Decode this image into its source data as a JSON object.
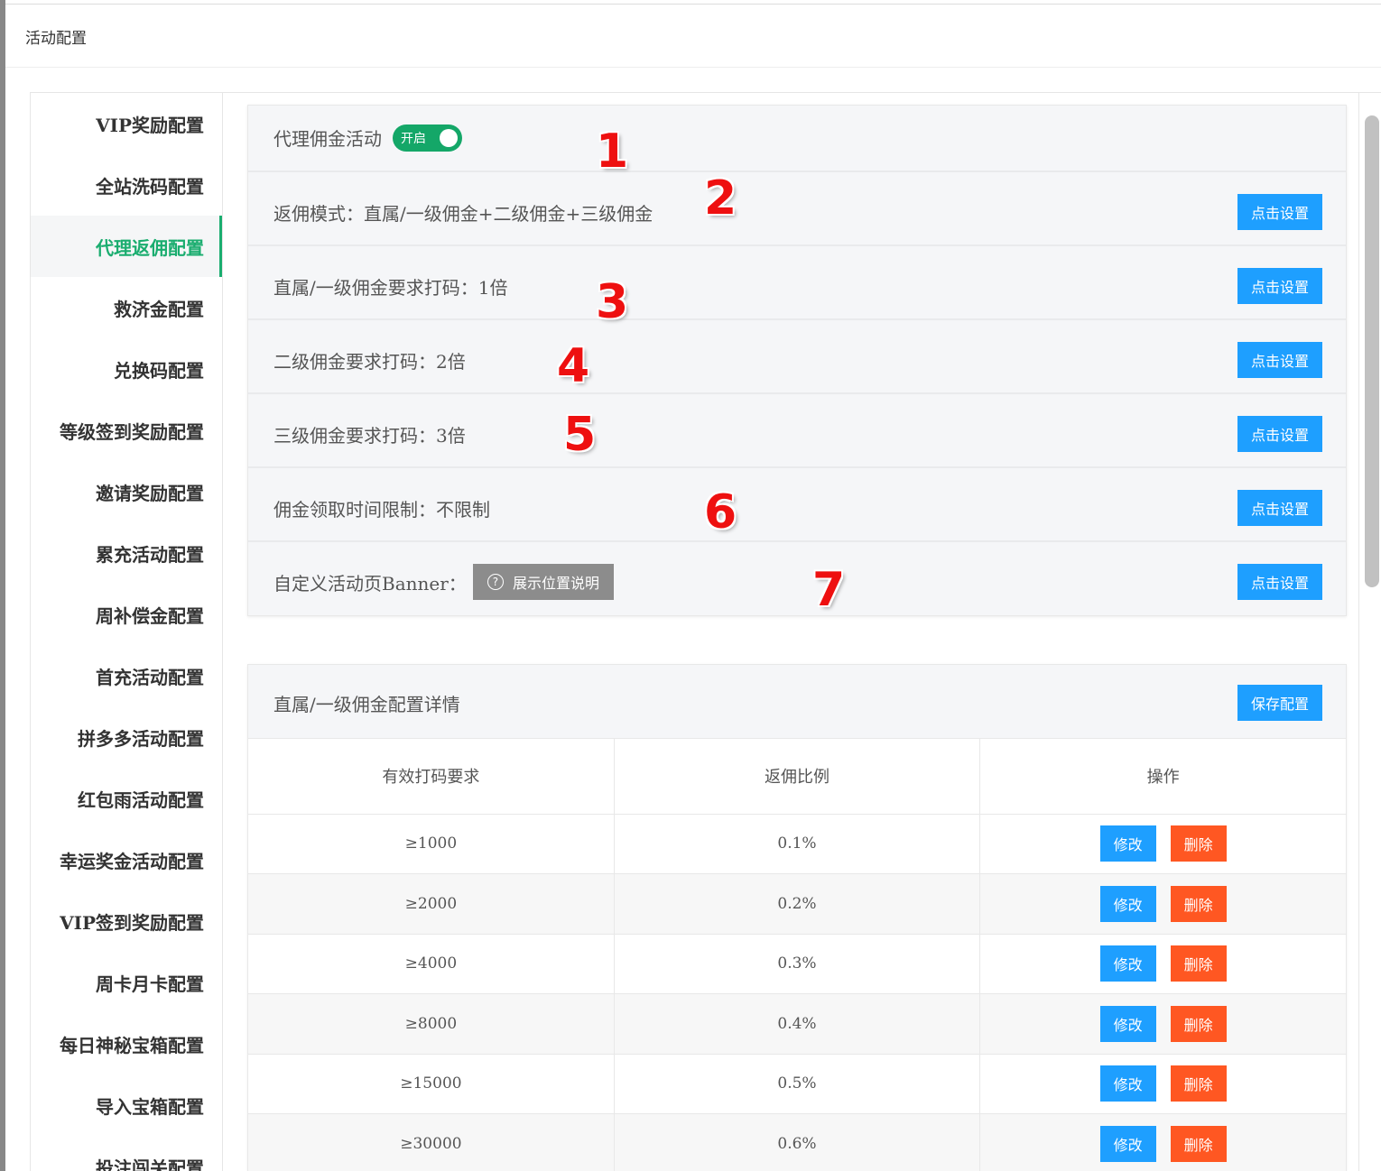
{
  "page_title": "活动配置",
  "sidebar": {
    "items": [
      {
        "label": "VIP奖励配置"
      },
      {
        "label": "全站洗码配置"
      },
      {
        "label": "代理返佣配置"
      },
      {
        "label": "救济金配置"
      },
      {
        "label": "兑换码配置"
      },
      {
        "label": "等级签到奖励配置"
      },
      {
        "label": "邀请奖励配置"
      },
      {
        "label": "累充活动配置"
      },
      {
        "label": "周补偿金配置"
      },
      {
        "label": "首充活动配置"
      },
      {
        "label": "拼多多活动配置"
      },
      {
        "label": "红包雨活动配置"
      },
      {
        "label": "幸运奖金活动配置"
      },
      {
        "label": "VIP签到奖励配置"
      },
      {
        "label": "周卡月卡配置"
      },
      {
        "label": "每日神秘宝箱配置"
      },
      {
        "label": "导入宝箱配置"
      },
      {
        "label": "投注闯关配置"
      }
    ],
    "active": "代理返佣配置"
  },
  "settings": {
    "activity_label": "代理佣金活动",
    "toggle_label": "开启",
    "toggle_on": true,
    "mode_label": "返佣模式：直属/一级佣金+二级佣金+三级佣金",
    "level1_label": "直属/一级佣金要求打码：1倍",
    "level2_label": "二级佣金要求打码：2倍",
    "level3_label": "三级佣金要求打码：3倍",
    "time_label": "佣金领取时间限制：不限制",
    "banner_label": "自定义活动页Banner：",
    "banner_help_button": "展示位置说明",
    "set_button": "点击设置"
  },
  "annotations": [
    "1",
    "2",
    "3",
    "4",
    "5",
    "6",
    "7"
  ],
  "detail": {
    "title": "直属/一级佣金配置详情",
    "save_button": "保存配置",
    "columns": [
      "有效打码要求",
      "返佣比例",
      "操作"
    ],
    "rows": [
      {
        "req": "≥1000",
        "ratio": "0.1%"
      },
      {
        "req": "≥2000",
        "ratio": "0.2%"
      },
      {
        "req": "≥4000",
        "ratio": "0.3%"
      },
      {
        "req": "≥8000",
        "ratio": "0.4%"
      },
      {
        "req": "≥15000",
        "ratio": "0.5%"
      },
      {
        "req": "≥30000",
        "ratio": "0.6%"
      }
    ],
    "edit_label": "修改",
    "delete_label": "删除"
  },
  "colors": {
    "accent_green": "#1aad6f",
    "primary_blue": "#1e9fff",
    "danger_orange": "#ff5722",
    "annotation_red": "#ee1010"
  }
}
